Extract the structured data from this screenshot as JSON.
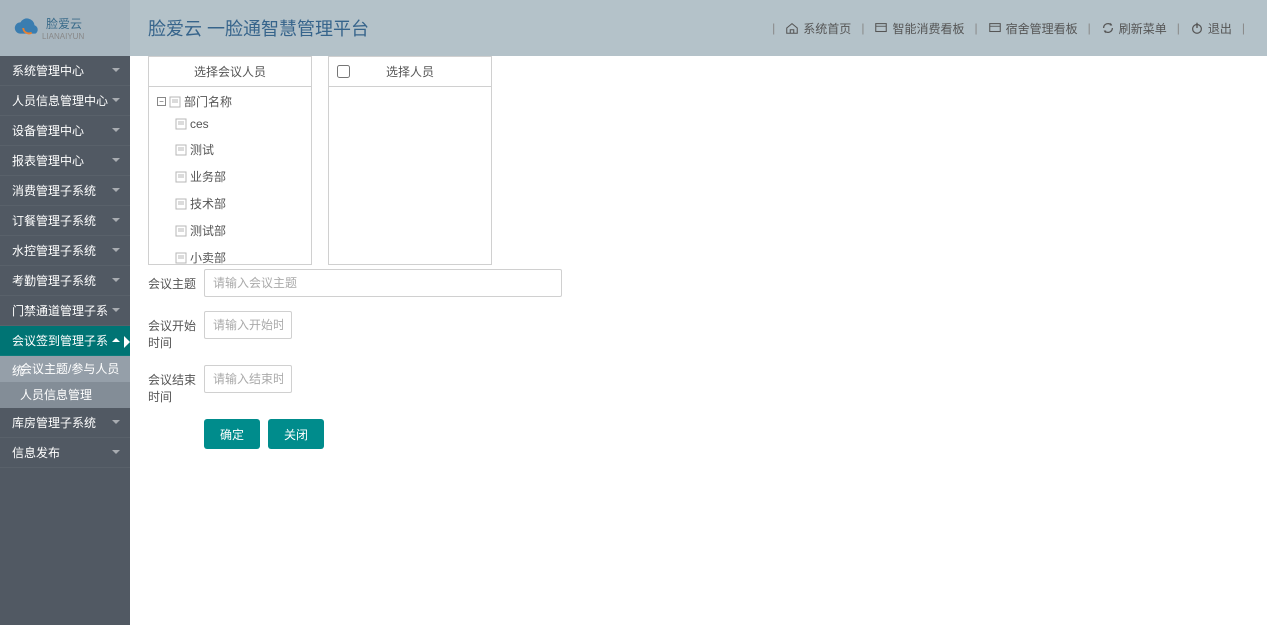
{
  "logo": {
    "name": "脸爱云",
    "sub": "LIANAIYUN"
  },
  "app_title": "脸爱云 一脸通智慧管理平台",
  "header_links": [
    {
      "label": "系统首页",
      "icon": "home"
    },
    {
      "label": "智能消费看板",
      "icon": "board"
    },
    {
      "label": "宿舍管理看板",
      "icon": "board"
    },
    {
      "label": "刷新菜单",
      "icon": "refresh"
    },
    {
      "label": "退出",
      "icon": "power"
    }
  ],
  "sidebar": {
    "items": [
      {
        "label": "系统管理中心"
      },
      {
        "label": "人员信息管理中心"
      },
      {
        "label": "设备管理中心"
      },
      {
        "label": "报表管理中心"
      },
      {
        "label": "消费管理子系统"
      },
      {
        "label": "订餐管理子系统"
      },
      {
        "label": "水控管理子系统"
      },
      {
        "label": "考勤管理子系统"
      },
      {
        "label": "门禁通道管理子系统"
      },
      {
        "label": "会议签到管理子系统",
        "active": true,
        "children": [
          {
            "label": "会议主题/参与人员"
          },
          {
            "label": "人员信息管理",
            "current": true
          }
        ]
      },
      {
        "label": "库房管理子系统"
      },
      {
        "label": "信息发布"
      }
    ]
  },
  "panel_left": {
    "title": "选择会议人员",
    "root": "部门名称",
    "nodes": [
      "ces",
      "测试",
      "业务部",
      "技术部",
      "测试部",
      "小卖部"
    ]
  },
  "panel_right": {
    "title": "选择人员"
  },
  "form": {
    "topic_label": "会议主题",
    "topic_placeholder": "请输入会议主题",
    "start_label": "会议开始时间",
    "start_placeholder": "请输入开始时间",
    "end_label": "会议结束时间",
    "end_placeholder": "请输入结束时间",
    "confirm": "确定",
    "close": "关闭"
  }
}
